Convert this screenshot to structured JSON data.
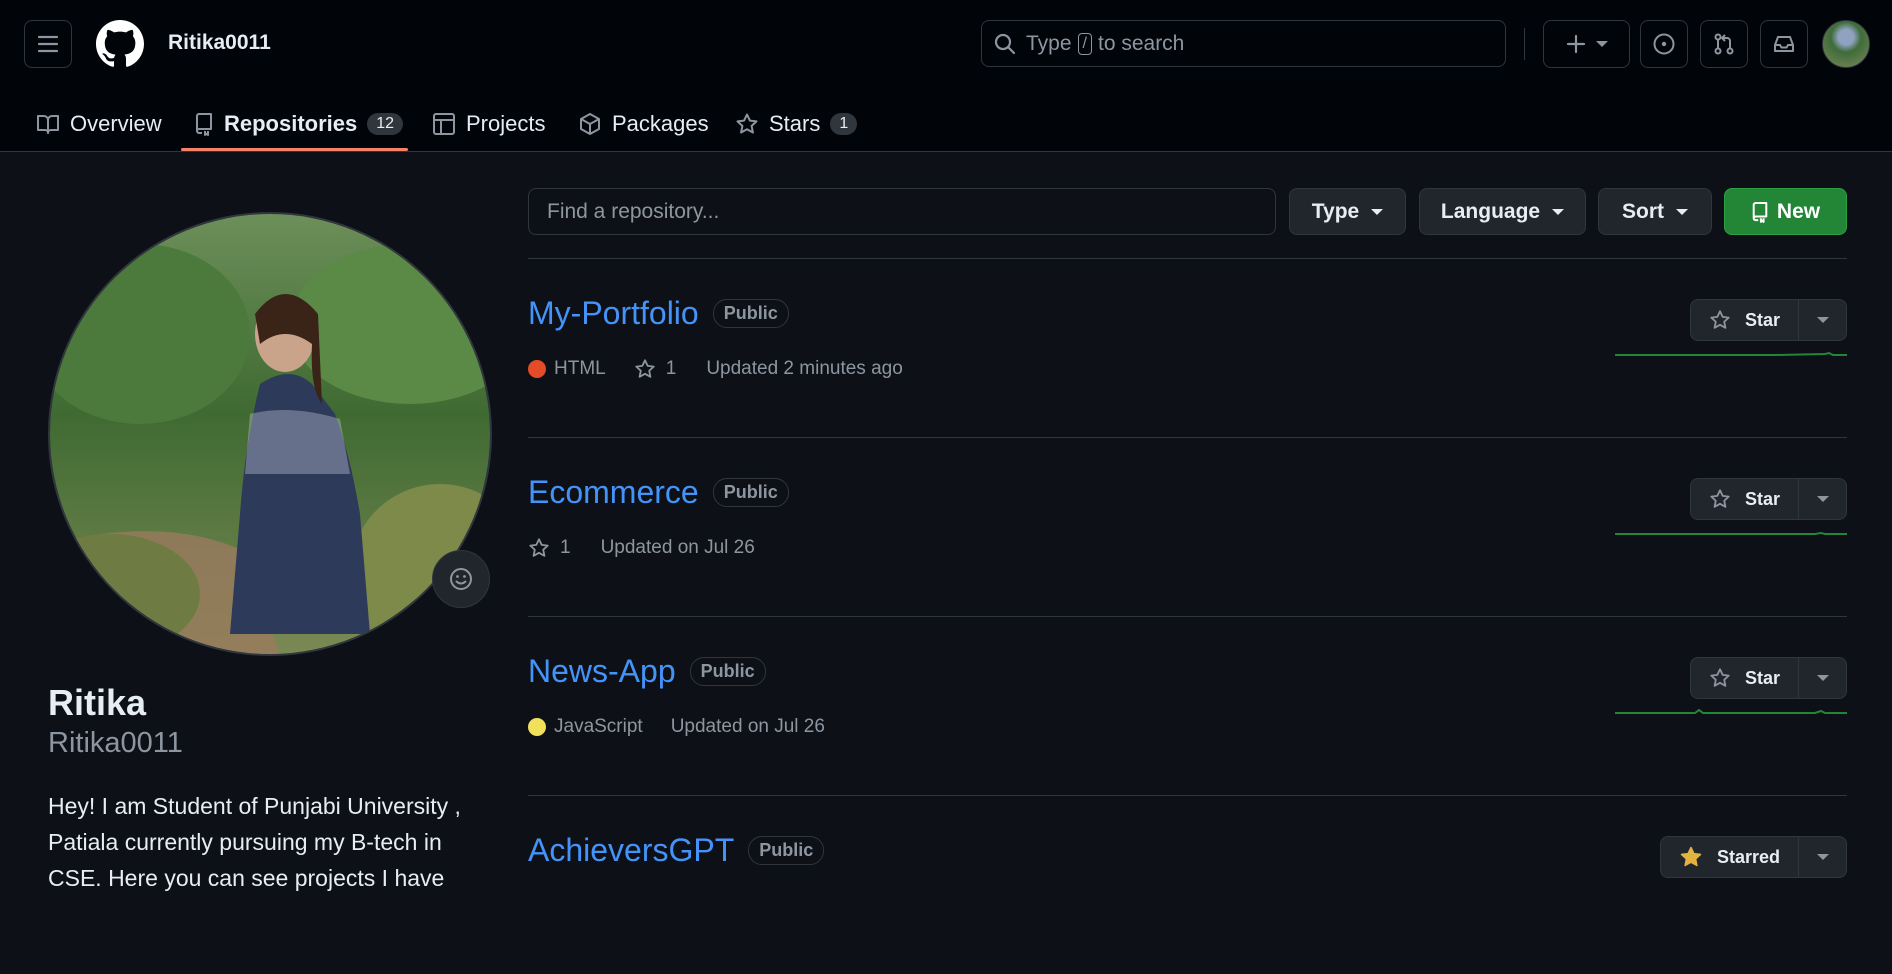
{
  "header": {
    "username": "Ritika0011",
    "search": {
      "prefix": "Type",
      "key": "/",
      "suffix": "to search"
    }
  },
  "tabs": {
    "overview": "Overview",
    "repositories": {
      "label": "Repositories",
      "count": "12"
    },
    "projects": "Projects",
    "packages": "Packages",
    "stars": {
      "label": "Stars",
      "count": "1"
    }
  },
  "profile": {
    "name": "Ritika",
    "login": "Ritika0011",
    "bio": "Hey! I am Student of Punjabi University , Patiala currently pursuing my B-tech in CSE. Here you can see projects I have"
  },
  "filters": {
    "find_placeholder": "Find a repository...",
    "type_label": "Type",
    "language_label": "Language",
    "sort_label": "Sort",
    "new_label": "New"
  },
  "repos": [
    {
      "name": "My-Portfolio",
      "visibility": "Public",
      "language": "HTML",
      "language_color": "#e34c26",
      "stars": "1",
      "updated": "Updated 2 minutes ago",
      "star_label": "Star",
      "starred": false
    },
    {
      "name": "Ecommerce",
      "visibility": "Public",
      "language": "",
      "language_color": "",
      "stars": "1",
      "updated": "Updated on Jul 26",
      "star_label": "Star",
      "starred": false
    },
    {
      "name": "News-App",
      "visibility": "Public",
      "language": "JavaScript",
      "language_color": "#f1e05a",
      "stars": "",
      "updated": "Updated on Jul 26",
      "star_label": "Star",
      "starred": false
    },
    {
      "name": "AchieversGPT",
      "visibility": "Public",
      "language": "",
      "language_color": "",
      "stars": "",
      "updated": "",
      "star_label": "Starred",
      "starred": true
    }
  ],
  "colors": {
    "accent": "#4493f8",
    "new_button": "#238636",
    "tab_underline": "#f78166",
    "sparkline": "#238636"
  }
}
